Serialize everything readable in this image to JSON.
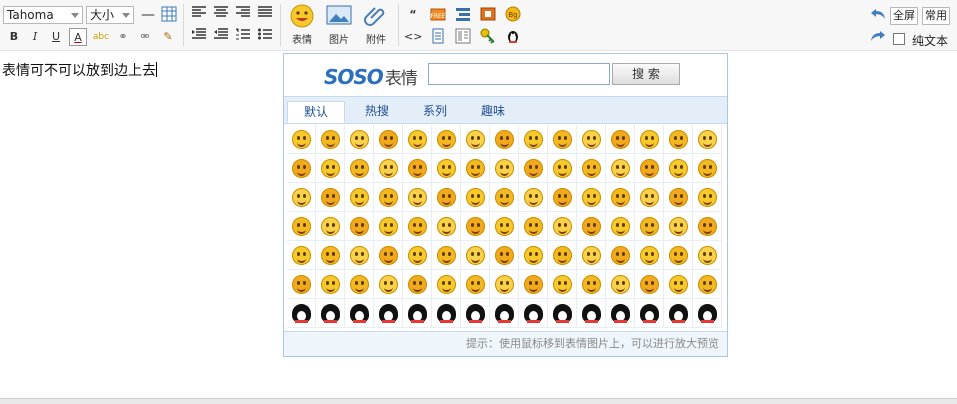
{
  "toolbar": {
    "font_family": "Tahoma",
    "font_size": "大小",
    "insert_emoticon_label": "表情",
    "insert_image_label": "图片",
    "insert_attachment_label": "附件",
    "fullscreen_label": "全屏",
    "common_label": "常用",
    "plain_text_label": "纯文本"
  },
  "editor": {
    "content_text": "表情可不可以放到边上去"
  },
  "emoticon_panel": {
    "logo_brand": "SOSO",
    "logo_text": "表情",
    "search_placeholder": "",
    "search_button": "搜 索",
    "tabs": [
      "默认",
      "热搜",
      "系列",
      "趣味"
    ],
    "active_tab": "默认",
    "hint": "提示：使用鼠标移到表情图片上，可以进行放大预览",
    "rows": 7,
    "cols": 15
  },
  "colors": {
    "panel_border": "#a9c7e2",
    "tab_bg": "#e4eef8",
    "emoji_yellow": "#f7c92a",
    "link_blue": "#1f4f8f"
  }
}
